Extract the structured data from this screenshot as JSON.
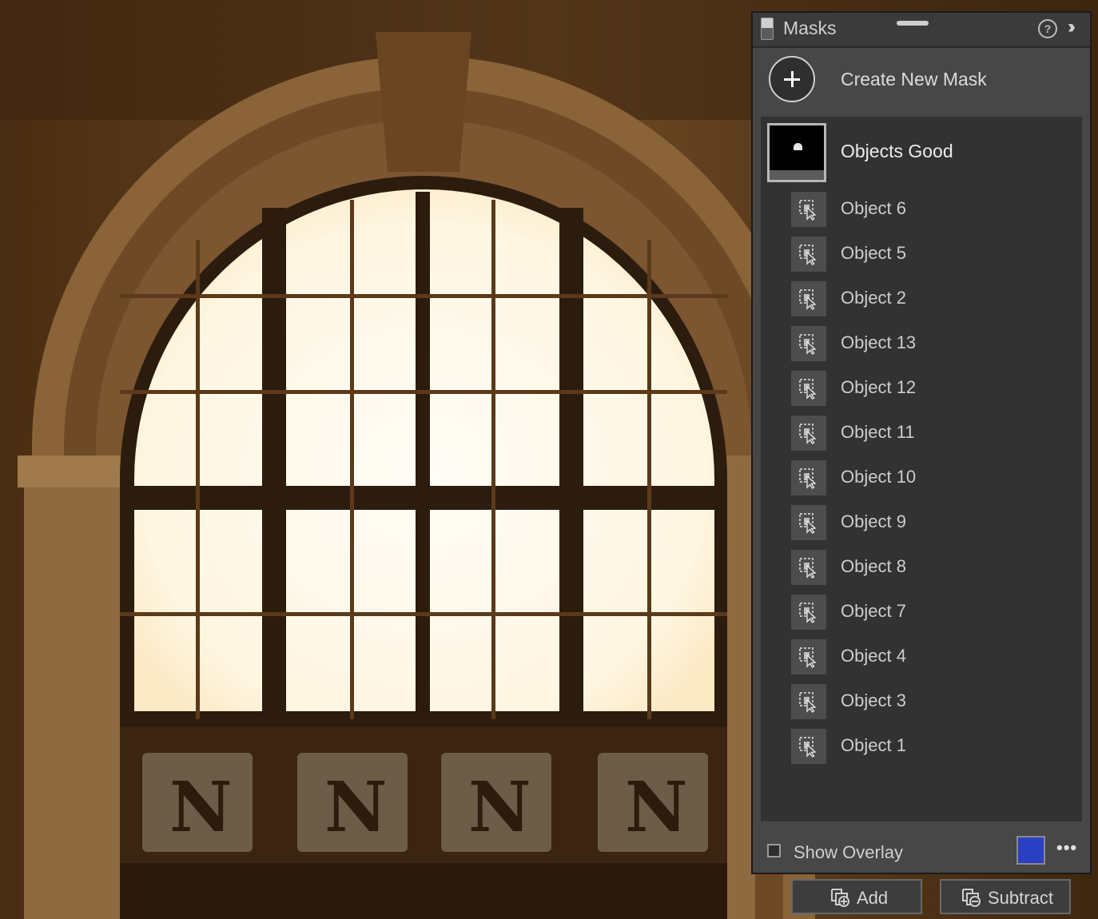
{
  "panel": {
    "title": "Masks",
    "help_icon": "help-circle-icon",
    "collapse_icon": "double-chevron-right-icon"
  },
  "create": {
    "label": "Create New Mask",
    "icon": "plus-icon"
  },
  "mask": {
    "name": "Objects Good"
  },
  "objects": [
    {
      "label": "Object 6"
    },
    {
      "label": "Object 5"
    },
    {
      "label": "Object 2"
    },
    {
      "label": "Object 13"
    },
    {
      "label": "Object 12"
    },
    {
      "label": "Object 11"
    },
    {
      "label": "Object 10"
    },
    {
      "label": "Object 9"
    },
    {
      "label": "Object 8"
    },
    {
      "label": "Object 7"
    },
    {
      "label": "Object 4"
    },
    {
      "label": "Object 3"
    },
    {
      "label": "Object 1"
    }
  ],
  "actions": {
    "add": "Add",
    "subtract": "Subtract"
  },
  "footer": {
    "show_overlay": "Show Overlay",
    "overlay_checked": false,
    "overlay_color": "#2b3fc4",
    "more": "•••"
  }
}
